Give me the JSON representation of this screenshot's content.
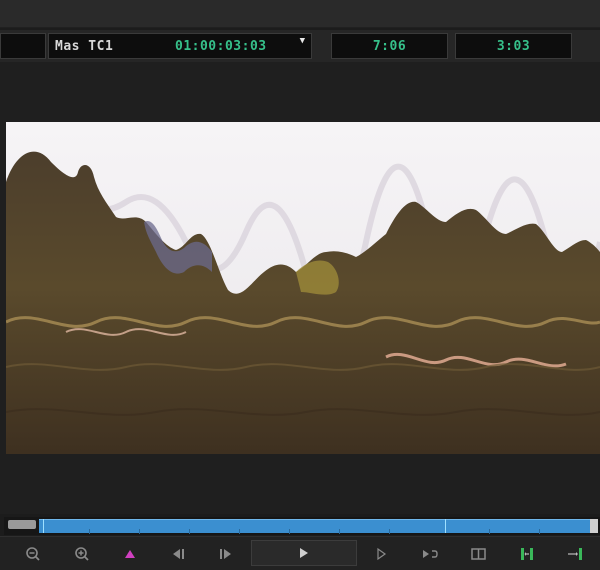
{
  "timecode_bar": {
    "main_label": "Mas TC1",
    "main_value": "01:00:03:03",
    "duration_value": "7:06",
    "remaining_value": "3:03"
  },
  "colors": {
    "timecode_text": "#36c08a",
    "scrub_track": "#3b8fd0",
    "mark_in": "#d040c0"
  },
  "toolbar_icons": [
    "zoom-out-icon",
    "zoom-in-icon",
    "mark-in-icon",
    "step-back-icon",
    "step-forward-icon",
    "play-icon",
    "play-in-to-out-icon",
    "loop-play-icon",
    "safe-margins-icon",
    "insert-icon",
    "overwrite-icon"
  ]
}
